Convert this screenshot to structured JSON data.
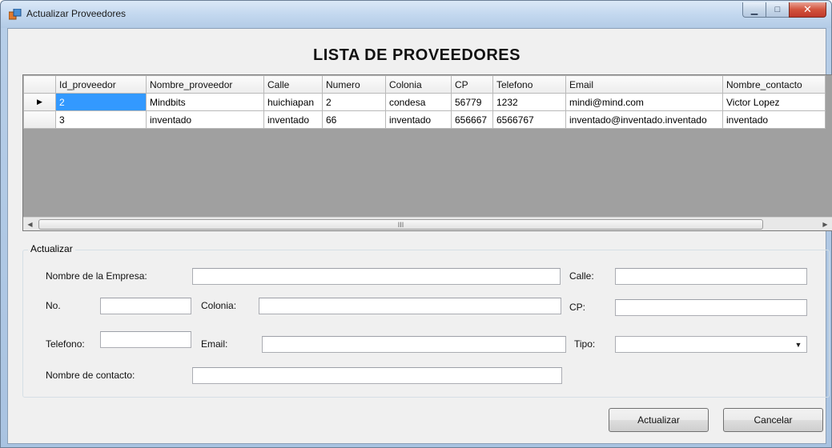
{
  "window": {
    "title": "Actualizar Proveedores"
  },
  "heading": "LISTA DE PROVEEDORES",
  "grid": {
    "columns": [
      "Id_proveedor",
      "Nombre_proveedor",
      "Calle",
      "Numero",
      "Colonia",
      "CP",
      "Telefono",
      "Email",
      "Nombre_contacto"
    ],
    "rows": [
      [
        "2",
        "Mindbits",
        "huichiapan",
        "2",
        "condesa",
        "56779",
        "1232",
        "mindi@mind.com",
        "Victor Lopez"
      ],
      [
        "3",
        "inventado",
        "inventado",
        "66",
        "inventado",
        "656667",
        "6566767",
        "inventado@inventado.inventado",
        "inventado"
      ]
    ],
    "current_row_marker": "▶",
    "scroll_grip": "III"
  },
  "form": {
    "group_title": "Actualizar",
    "labels": {
      "empresa": "Nombre de la Empresa:",
      "calle": "Calle:",
      "no": "No.",
      "colonia": "Colonia:",
      "cp": "CP:",
      "telefono": "Telefono:",
      "email": "Email:",
      "tipo": "Tipo:",
      "contacto": "Nombre de contacto:"
    },
    "values": {
      "empresa": "",
      "calle": "",
      "no": "",
      "colonia": "",
      "cp": "",
      "telefono": "",
      "email": "",
      "tipo": "",
      "contacto": ""
    }
  },
  "buttons": {
    "actualizar": "Actualizar",
    "cancelar": "Cancelar"
  },
  "colors": {
    "selection": "#3399ff",
    "grid_background": "#a0a0a0",
    "close_button": "#c0392b"
  }
}
